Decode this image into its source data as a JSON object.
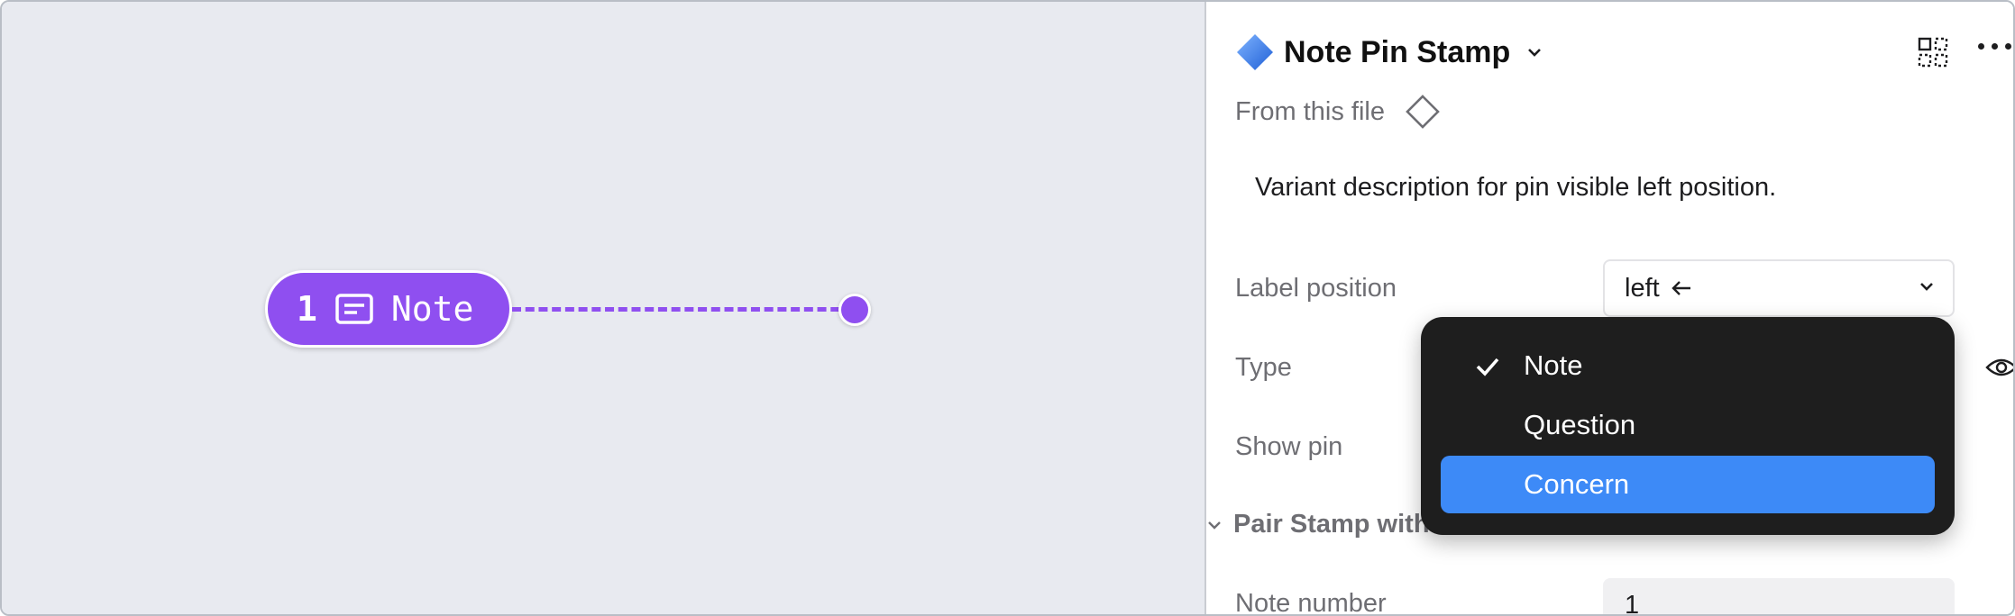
{
  "canvas": {
    "pin": {
      "number": "1",
      "icon": "note-icon",
      "label": "Note",
      "color": "#8f4ff0"
    }
  },
  "panel": {
    "component_icon": "component-diamond-icon",
    "title": "Note Pin Stamp",
    "from_text": "From this file",
    "description": "Variant description for pin visible left position.",
    "properties": {
      "label_position": {
        "label": "Label position",
        "value": "left",
        "arrow_icon": "arrow-left-icon"
      },
      "type": {
        "label": "Type"
      },
      "show_pin": {
        "label": "Show pin"
      },
      "section_title": "Pair Stamp with",
      "note_number": {
        "label": "Note number",
        "value": "1"
      }
    }
  },
  "dropdown": {
    "items": [
      {
        "label": "Note",
        "checked": true,
        "highlighted": false
      },
      {
        "label": "Question",
        "checked": false,
        "highlighted": false
      },
      {
        "label": "Concern",
        "checked": false,
        "highlighted": true
      }
    ],
    "highlight_color": "#3d8af7",
    "background_color": "#1e1e1e"
  }
}
